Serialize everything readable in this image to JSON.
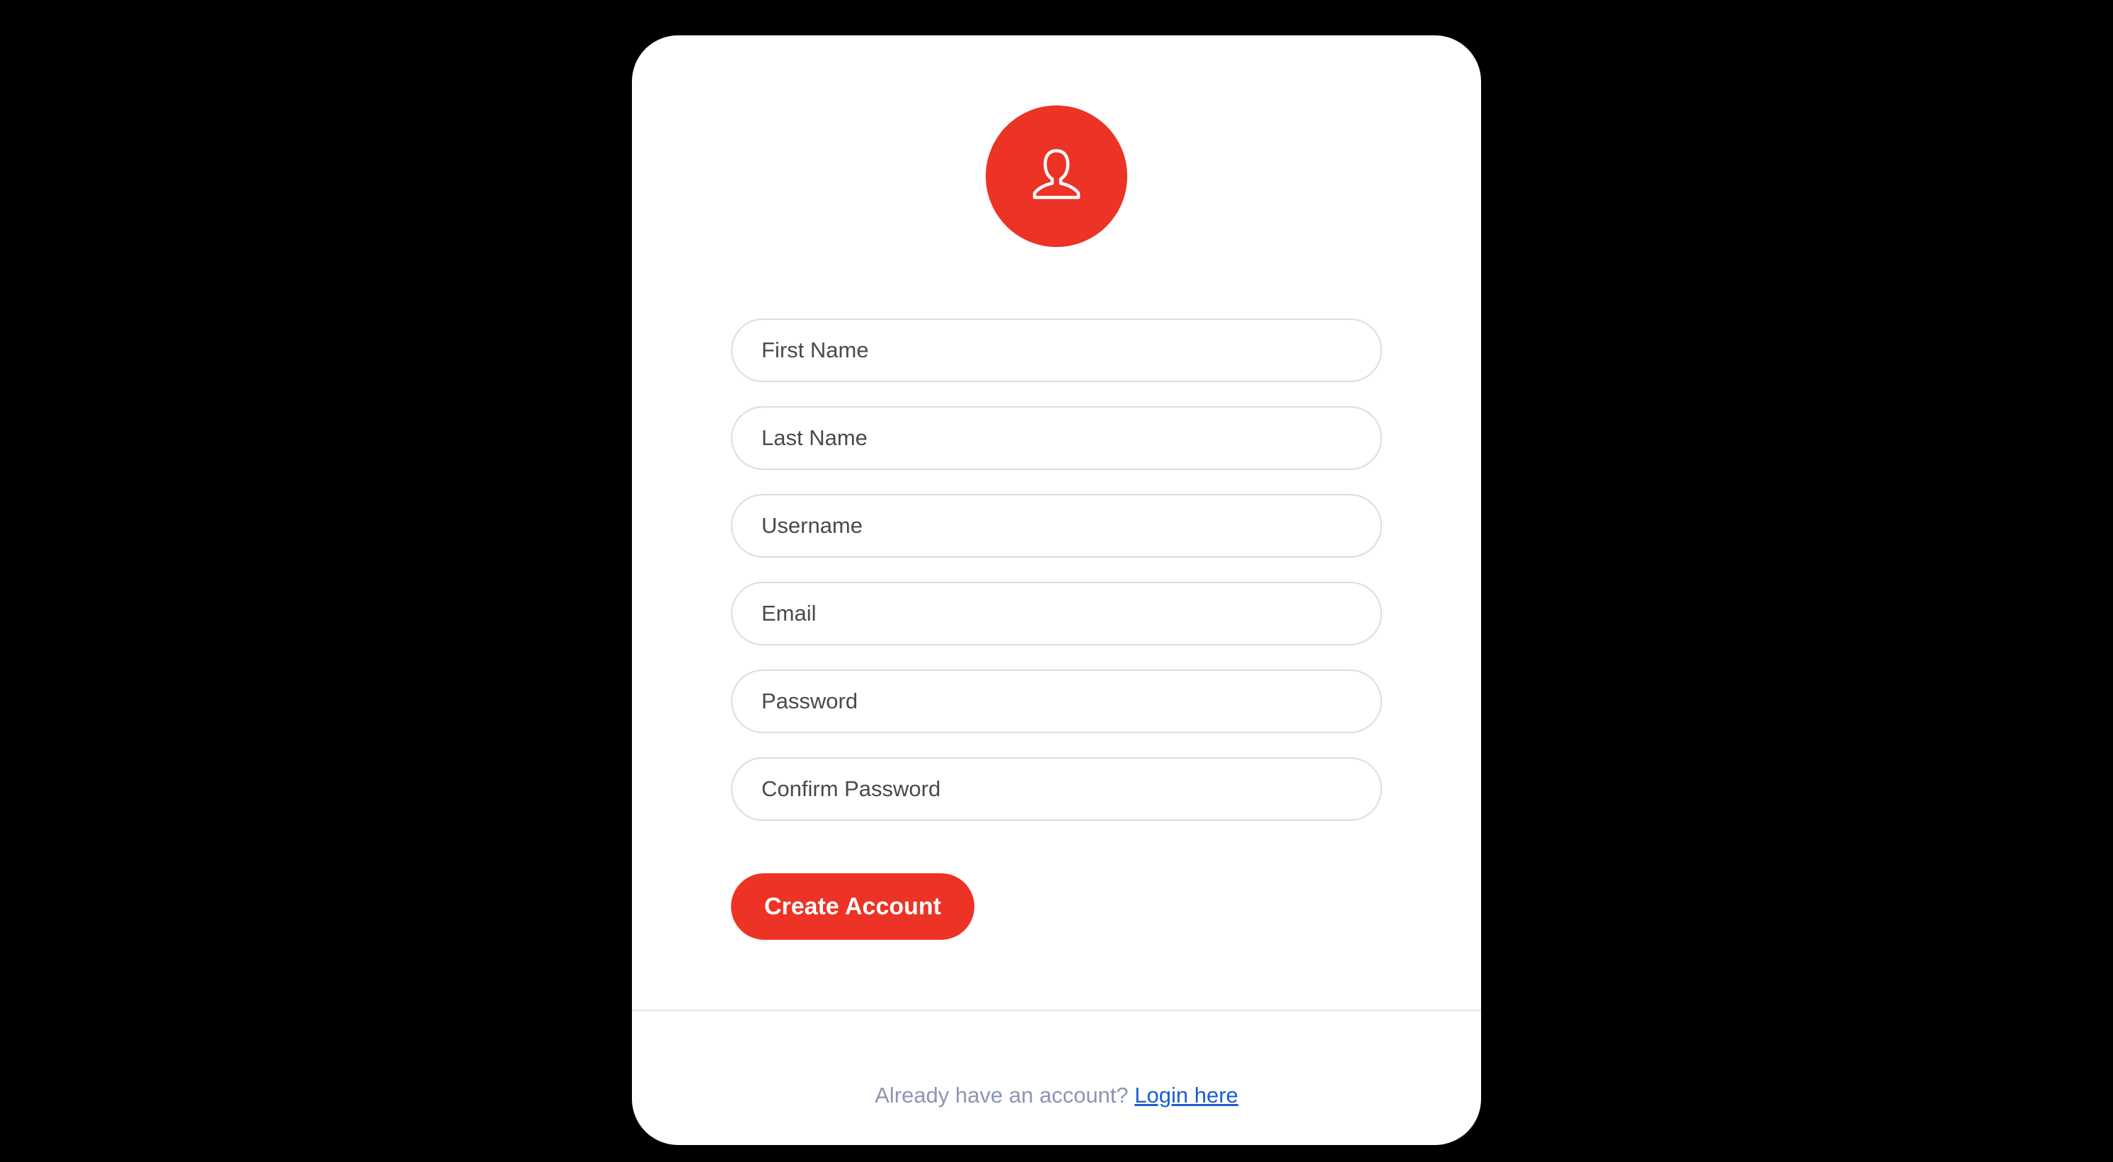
{
  "colors": {
    "background": "#000000",
    "card": "#ffffff",
    "accent": "#ec3325",
    "link": "#1a5fd0",
    "muted_text": "#8a96b3"
  },
  "avatar": {
    "icon": "user-icon"
  },
  "form": {
    "fields": [
      {
        "placeholder": "First Name",
        "value": ""
      },
      {
        "placeholder": "Last Name",
        "value": ""
      },
      {
        "placeholder": "Username",
        "value": ""
      },
      {
        "placeholder": "Email",
        "value": ""
      },
      {
        "placeholder": "Password",
        "value": ""
      },
      {
        "placeholder": "Confirm Password",
        "value": ""
      }
    ],
    "submit_label": "Create Account"
  },
  "footer": {
    "prompt": "Already have an account?",
    "link_label": "Login here"
  }
}
